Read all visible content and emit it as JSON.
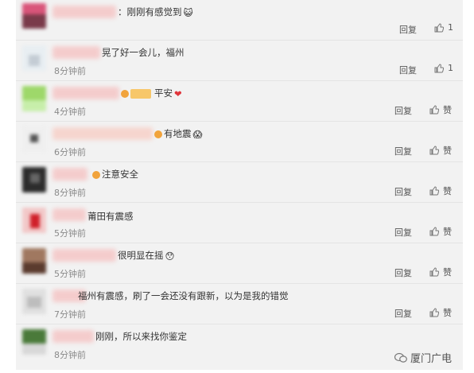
{
  "comments": [
    {
      "text": "：刚刚有感觉到",
      "emoji": "😺",
      "time": "",
      "reply": "回复",
      "like": "1"
    },
    {
      "text": "晃了好一会儿，福州",
      "emoji": "",
      "time": "8分钟前",
      "reply": "回复",
      "like": "1"
    },
    {
      "text": "平安",
      "emoji": "❤",
      "time": "4分钟前",
      "reply": "回复",
      "like": "赞"
    },
    {
      "text": "有地震",
      "emoji": "😱",
      "time": "6分钟前",
      "reply": "回复",
      "like": "赞"
    },
    {
      "text": "注意安全",
      "emoji": "",
      "time": "8分钟前",
      "reply": "回复",
      "like": "赞"
    },
    {
      "text": "莆田有震感",
      "emoji": "",
      "time": "5分钟前",
      "reply": "回复",
      "like": "赞"
    },
    {
      "text": "很明显在摇",
      "emoji": "😯",
      "time": "5分钟前",
      "reply": "回复",
      "like": "赞"
    },
    {
      "text": "福州有震感，刷了一会还没有跟新，以为是我的错觉",
      "emoji": "",
      "time": "7分钟前",
      "reply": "回复",
      "like": "赞"
    },
    {
      "text": "刚刚，所以来找你鉴定",
      "emoji": "",
      "time": "8分钟前",
      "reply": "回复",
      "like": "赞"
    }
  ],
  "watermark": "厦门广电"
}
